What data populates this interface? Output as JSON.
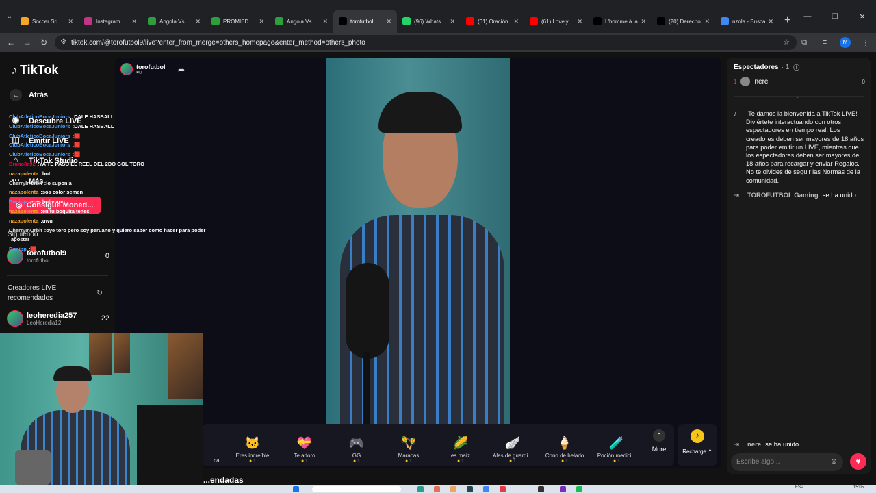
{
  "browser": {
    "tabs": [
      {
        "label": "Soccer Scores",
        "color": "#f5a623"
      },
      {
        "label": "Instagram",
        "color": "#c13584"
      },
      {
        "label": "Angola Vs Arg",
        "color": "#2e9e3e"
      },
      {
        "label": "PROMIEDOS",
        "color": "#2e9e3e"
      },
      {
        "label": "Angola Vs Arg",
        "color": "#2e9e3e"
      },
      {
        "label": "torofutbol",
        "color": "#000000"
      },
      {
        "label": "(96) WhatsApp",
        "color": "#25d366"
      },
      {
        "label": "(61) Oración",
        "color": "#ff0000"
      },
      {
        "label": "(61) Lovely",
        "color": "#ff0000"
      },
      {
        "label": "L'homme à la",
        "color": "#000000"
      },
      {
        "label": "(20) Derecho",
        "color": "#000000"
      },
      {
        "label": "nzola - Busca",
        "color": "#4285f4"
      }
    ],
    "active_tab": 5,
    "url": "tiktok.com/@torofutbol9/live?enter_from_merge=others_homepage&enter_method=others_photo",
    "profile_initial": "M"
  },
  "sidebar": {
    "logo": "TikTok",
    "back": "Atrás",
    "nav": [
      "Descubre LIVE",
      "Emitir LIVE",
      "TikTok Studio",
      "Más"
    ],
    "coins_button": "Consigue Moned...",
    "following_label": "Siguiendo",
    "following": [
      {
        "name": "torofutbol9",
        "handle": "torofutbol",
        "count": "0"
      }
    ],
    "recommended_label_1": "Creadores LIVE",
    "recommended_label_2": "recomendados",
    "recommended": [
      {
        "name": "leoheredia257",
        "handle": "LeoHeredia12",
        "count": "22"
      }
    ]
  },
  "overlay_chat": [
    {
      "user": "ClubAtleticoBocaJuniors",
      "text": "DALE HASBALL",
      "color": "b"
    },
    {
      "user": "ClubAtleticoBocaJuniors",
      "text": "DALE HASBALL",
      "color": "b"
    },
    {
      "user": "ClubAtleticoBocaJuniors",
      "text": "🟥",
      "color": "b"
    },
    {
      "user": "ClubAtleticoBocaJuniors",
      "text": "🟥",
      "color": "b"
    },
    {
      "user": "ClubAtleticoBocaJuniors",
      "text": "🟥",
      "color": "b"
    },
    {
      "user": "Bruno8a92",
      "text": "YA TE PASO EL REEL DEL 2DO GOL TORO",
      "color": "r"
    },
    {
      "user": "nazapolenta",
      "text": "bot",
      "color": "o"
    },
    {
      "user": "CherryInOrbit",
      "text": "lo suponia",
      "color": "w"
    },
    {
      "user": "nazapolenta",
      "text": "sos color semen",
      "color": "o"
    },
    {
      "user": "Donipp",
      "text": "eres boliviano",
      "color": "b"
    },
    {
      "user": "nazapolenta",
      "text": "en tu boquita tenes",
      "color": "o"
    },
    {
      "user": "nazapolenta",
      "text": "uwu",
      "color": "o"
    },
    {
      "user": "CherryInOrbit",
      "text": "oye toro pero soy peruano y quiero saber como hacer para poder",
      "color": "w"
    },
    {
      "user": "",
      "text": "apostar",
      "color": "w"
    },
    {
      "user": "Donipp",
      "text": "🟥",
      "color": "b"
    }
  ],
  "live": {
    "host_name": "torofutbol",
    "host_likes": "♥0",
    "gifts": [
      {
        "name": "...ca",
        "icon": "🌹",
        "price": ""
      },
      {
        "name": "Eres increíble",
        "icon": "🐱",
        "price": "1"
      },
      {
        "name": "Te adoro",
        "icon": "💝",
        "price": "1"
      },
      {
        "name": "GG",
        "icon": "🎮",
        "price": "1"
      },
      {
        "name": "Maracas",
        "icon": "🪇",
        "price": "1"
      },
      {
        "name": "es maíz",
        "icon": "🌽",
        "price": "1"
      },
      {
        "name": "Alas de guardi...",
        "icon": "🪽",
        "price": "1"
      },
      {
        "name": "Cono de helado",
        "icon": "🍦",
        "price": "1"
      },
      {
        "name": "Poción medici...",
        "icon": "🧪",
        "price": "1"
      }
    ],
    "more": "More",
    "recharge": "Recharge ⌃",
    "bottom_title": "...endadas"
  },
  "right_panel": {
    "spectators_label": "Espectadores",
    "spectators_count": "· 1",
    "viewers": [
      {
        "rank": "1",
        "name": "nere",
        "score": "0"
      }
    ],
    "welcome": "¡Te damos la bienvenida a TikTok LIVE! Diviértete interactuando con otros espectadores en tiempo real. Los creadores deben ser mayores de 18 años para poder emitir un LIVE, mientras que los espectadores deben ser mayores de 18 años para recargar y enviar Regalos. No te olvides de seguir las Normas de la comunidad.",
    "join1_name": "TOROFUTBOL Gaming",
    "join1_text": "se ha unido",
    "join2_name": "nere",
    "join2_text": "se ha unido",
    "chat_placeholder": "Escribe algo..."
  },
  "taskbar": {
    "lang": "ESP",
    "time": "15:05"
  }
}
